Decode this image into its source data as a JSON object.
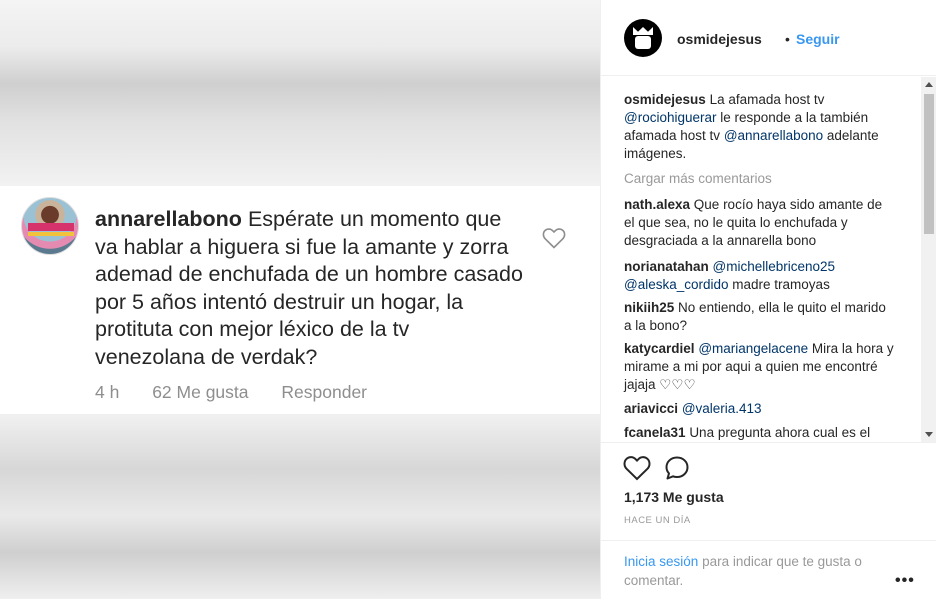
{
  "image_card": {
    "username": "annarellabono",
    "comment": "Espérate un momento que va hablar a higuera si fue la amante y zorra ademad de enchufada de un hombre casado por 5 años intentó destruir un hogar, la protituta con mejor léxico de la tv venezolana de verdak?",
    "time": "4 h",
    "likes": "62 Me gusta",
    "reply": "Responder",
    "heart_icon": "heart-outline-icon"
  },
  "header": {
    "username": "osmidejesus",
    "dot": "•",
    "follow": "Seguir"
  },
  "caption": {
    "username": "osmidejesus",
    "text_1": "La afamada host tv",
    "mention_1": "@rociohiguerar",
    "text_2": "le responde a la también afamada host tv",
    "mention_2": "@annarellabono",
    "text_3": "adelante imágenes."
  },
  "load_more": "Cargar más comentarios",
  "comments": [
    {
      "username": "nath.alexa",
      "text": "Que rocío haya sido amante de el que sea, no le quita lo enchufada y desgraciada a la annarella bono"
    },
    {
      "username": "norianatahan",
      "mention_1": "@michellebriceno25",
      "mention_2": "@aleska_cordido",
      "text": "madre tramoyas"
    },
    {
      "username": "nikiih25",
      "text": "No entiendo, ella le quito el marido a la bono?"
    },
    {
      "username": "katycardiel",
      "mention": "@mariangelacene",
      "text": "Mira la hora y mirame a mi por aqui a quien me encontré jajaja ♡♡♡"
    },
    {
      "username": "ariavicci",
      "mention": "@valeria.413"
    },
    {
      "username": "fcanela31",
      "text": "Una pregunta ahora cual es el"
    }
  ],
  "actions": {
    "likes": "1,173 Me gusta",
    "time_ago": "HACE UN DÍA"
  },
  "login": {
    "link": "Inicia sesión",
    "text": "para indicar que te gusta o comentar.",
    "more": "•••"
  },
  "colors": {
    "link_blue": "#3897f0",
    "mention_blue": "#003569",
    "text": "#262626",
    "muted": "#999999"
  }
}
